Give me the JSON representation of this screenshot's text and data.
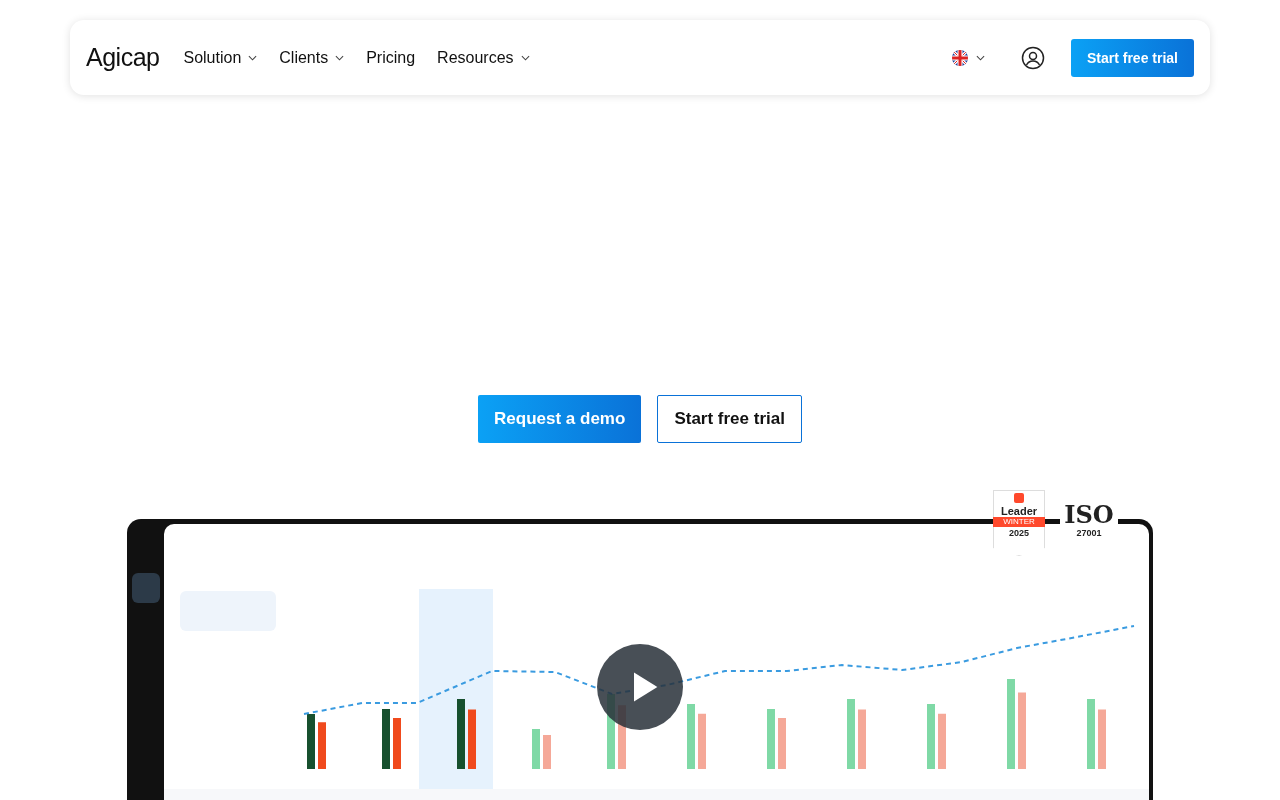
{
  "nav": {
    "logo": "Agicap",
    "items": [
      {
        "label": "Solution",
        "has_menu": true
      },
      {
        "label": "Clients",
        "has_menu": true
      },
      {
        "label": "Pricing",
        "has_menu": false
      },
      {
        "label": "Resources",
        "has_menu": true
      }
    ],
    "cta": "Start free trial"
  },
  "hero": {
    "buttons": [
      {
        "label": "Request a demo",
        "kind": "primary"
      },
      {
        "label": "Start free trial",
        "kind": "outline"
      }
    ]
  },
  "badges": [
    {
      "kind": "g2",
      "title": "Leader",
      "season": "WINTER",
      "year": "2025"
    },
    {
      "kind": "iso",
      "title": "ISO",
      "number": "27001"
    }
  ]
}
